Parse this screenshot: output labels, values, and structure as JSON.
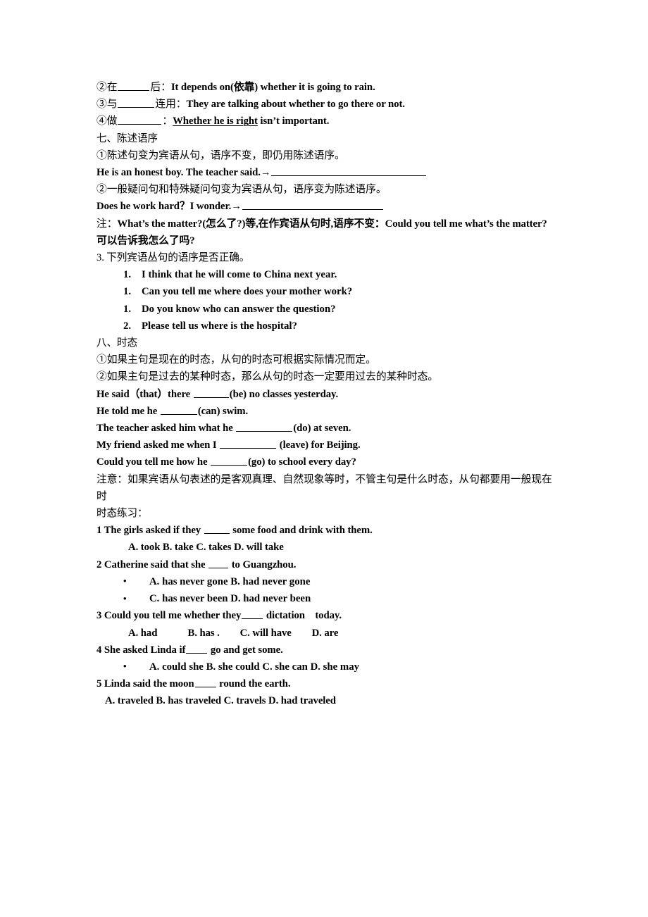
{
  "document": {
    "whether_usages": [
      {
        "id": "line-whether-2",
        "cn_prefix": "②在",
        "blank": "b-45",
        "cn_mid": "后：",
        "en": "It depends on(依靠) whether it is going to rain."
      },
      {
        "id": "line-whether-3",
        "cn_prefix": "③与",
        "blank": "b-52",
        "cn_mid": "连用：",
        "en": "They are talking about whether to go there or not."
      },
      {
        "id": "line-whether-4",
        "cn_prefix": "④做",
        "blank": "b-62",
        "cn_mid": "：",
        "en_underlined": "Whether he is right",
        "en_rest": " isn’t important."
      }
    ],
    "section7": {
      "heading": "七、陈述语序",
      "rule1": "①陈述句变为宾语从句，语序不变，即仍用陈述语序。",
      "example1": "He is an honest boy. The teacher said.",
      "arrow": "→",
      "rule2": "②一般疑问句和特殊疑问句变为宾语从句，语序变为陈述语序。",
      "example2": "Does he work hard？I wonder.",
      "note_label": "注：",
      "note_text": "What’s the matter?(怎么了?)等,在作宾语从句时,语序不变：Could you tell me what’s the matter?  可以告诉我怎么了吗?",
      "exercise_heading": "3. 下列宾语丛句的语序是否正确。",
      "exercise_items": [
        {
          "marker": "1.",
          "text": "I think that he will come to China next year."
        },
        {
          "marker": "1.",
          "text": "Can you tell me where does your mother work?"
        },
        {
          "marker": "1.",
          "text": "Do you know who can answer the question?"
        },
        {
          "marker": "2.",
          "text": "Please tell us where is the hospital?"
        }
      ]
    },
    "section8": {
      "heading": "八、时态",
      "rule1": "①如果主句是现在的时态，从句的时态可根据实际情况而定。",
      "rule2": "②如果主句是过去的某种时态，那么从句的时态一定要用过去的某种时态。",
      "fill_sentences": [
        {
          "before": "He said（that）there ",
          "blank": "b-50",
          "after": "(be) no classes yesterday."
        },
        {
          "before": "He told me he ",
          "blank": "b-52",
          "after": "(can) swim."
        },
        {
          "before": "The teacher asked him what he ",
          "blank": "b-80",
          "after": "(do) at seven."
        },
        {
          "before": "My friend asked me when I ",
          "blank": "b-80",
          "after": " (leave) for Beijing."
        },
        {
          "before": "Could you tell me how he ",
          "blank": "b-52",
          "after": "(go) to school every day?"
        }
      ],
      "caution_label": "注意：",
      "caution_text": "如果宾语从句表述的是客观真理、自然现象等时，不管主句是什么时态，从句都要用一般现在时",
      "practice_heading": "时态练习："
    },
    "practice": [
      {
        "id": "q1",
        "stem_before": "1 The girls asked if they ",
        "stem_blank": "b-36",
        "stem_after": " some food and drink with them.",
        "options": [
          {
            "style": "indent",
            "text": "A. took B. take C. takes D. will take"
          }
        ]
      },
      {
        "id": "q2",
        "stem_before": "2 Catherine said that she ",
        "stem_blank": "b-28",
        "stem_after": " to Guangzhou.",
        "options": [
          {
            "style": "bullet",
            "text": "A. has never gone B. had never gone"
          },
          {
            "style": "bullet",
            "text": "C. has never been D. had never been"
          }
        ]
      },
      {
        "id": "q3",
        "stem_before": "3 Could you tell me whether they",
        "stem_blank": "b-30",
        "stem_after": " dictation    today.",
        "options": [
          {
            "style": "indent",
            "text": "A. had            B. has .        C. will have        D. are"
          }
        ]
      },
      {
        "id": "q4",
        "stem_before": "4 She asked Linda if",
        "stem_blank": "b-30",
        "stem_after": " go and get some.",
        "options": [
          {
            "style": "bullet",
            "text": "A. could she B. she could C. she can D. she may"
          }
        ]
      },
      {
        "id": "q5",
        "stem_before": "5 Linda said the moon",
        "stem_blank": "b-30",
        "stem_after": " round the earth.",
        "options": [
          {
            "style": "indent-sm",
            "text": "A. traveled B. has traveled C. travels D. had traveled"
          }
        ]
      }
    ]
  }
}
